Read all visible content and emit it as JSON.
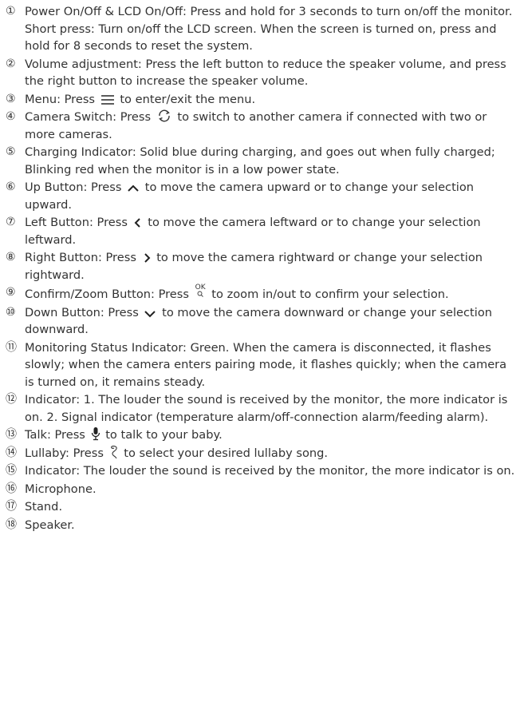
{
  "items": [
    {
      "num": "①",
      "a": "Power On/Off & LCD On/Off: Press and hold for 3 seconds to turn on/off the monitor. Short press: Turn on/off the LCD screen. When the screen is turned on, press and hold for 8 seconds to reset the system."
    },
    {
      "num": "②",
      "a": "Volume adjustment: Press the left button to reduce the speaker volume, and press the right button to increase the speaker volume."
    },
    {
      "num": "③",
      "a": "Menu: Press",
      "icon": "menu-icon",
      "b": "to enter/exit the menu."
    },
    {
      "num": "④",
      "a": "Camera Switch:  Press",
      "icon": "camera-switch-icon",
      "b": "to switch to another camera if connected with two or more cameras."
    },
    {
      "num": "⑤",
      "a": "Charging Indicator: Solid blue during charging, and goes out when fully charged; Blinking red when the monitor is in a low power state."
    },
    {
      "num": "⑥",
      "a": "Up Button: Press",
      "icon": "chevron-up-icon",
      "b": "to move the camera upward or to change your selection upward."
    },
    {
      "num": "⑦",
      "a": "Left Button: Press",
      "icon": "chevron-left-icon",
      "b": "to move the camera leftward or to change your selection leftward."
    },
    {
      "num": "⑧",
      "a": "Right Button: Press",
      "icon": "chevron-right-icon",
      "b": "to move the camera rightward or change your selection rightward."
    },
    {
      "num": "⑨",
      "a": "Confirm/Zoom Button: Press",
      "icon": "ok-zoom-icon",
      "b": "to zoom in/out to confirm your selection."
    },
    {
      "num": "⑩",
      "a": "Down Button: Press",
      "icon": "chevron-down-icon",
      "b": "to move the camera downward or change your selection downward."
    },
    {
      "num": "⑪",
      "a": "Monitoring Status Indicator: Green. When the camera is disconnected, it flashes slowly; when the camera enters pairing mode, it flashes quickly; when the camera is turned on, it remains steady."
    },
    {
      "num": "⑫",
      "a": "Indicator: 1. The louder the sound is received by the monitor, the more indicator is on. 2. Signal indicator (temperature alarm/off-connection alarm/feeding alarm)."
    },
    {
      "num": "⑬",
      "a": "Talk: Press",
      "icon": "microphone-icon",
      "b": "to talk to your baby."
    },
    {
      "num": "⑭",
      "a": "Lullaby: Press",
      "icon": "lullaby-icon",
      "b": "to select your desired lullaby song."
    },
    {
      "num": "⑮",
      "a": "Indicator: The louder the sound is received by the monitor, the  more indicator is on."
    },
    {
      "num": "⑯",
      "a": "Microphone."
    },
    {
      "num": "⑰",
      "a": "Stand."
    },
    {
      "num": "⑱",
      "a": "Speaker."
    }
  ],
  "ok_icon_text": "OK"
}
